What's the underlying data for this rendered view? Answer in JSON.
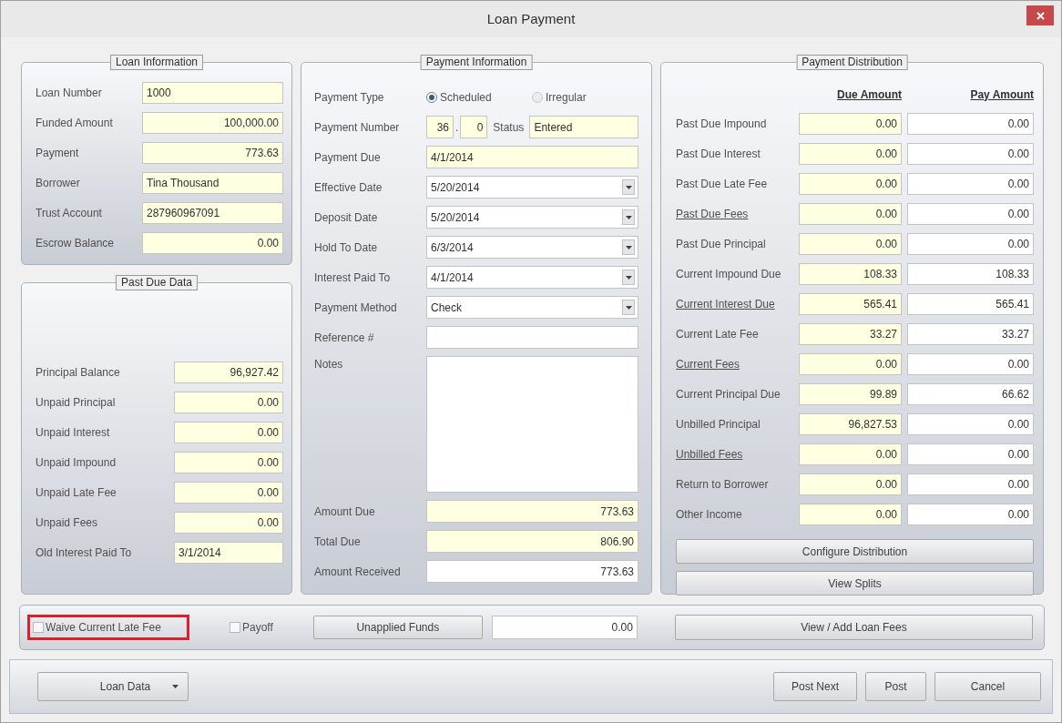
{
  "window": {
    "title": "Loan Payment"
  },
  "loan_information": {
    "title": "Loan Information",
    "fields": [
      {
        "label": "Loan Number",
        "value": "1000",
        "kind": "text"
      },
      {
        "label": "Funded Amount",
        "value": "100,000.00",
        "kind": "amount"
      },
      {
        "label": "Payment",
        "value": "773.63",
        "kind": "amount"
      },
      {
        "label": "Borrower",
        "value": "Tina Thousand",
        "kind": "text"
      },
      {
        "label": "Trust Account",
        "value": "287960967091",
        "kind": "text"
      },
      {
        "label": "Escrow Balance",
        "value": "0.00",
        "kind": "amount"
      }
    ]
  },
  "past_due_data": {
    "title": "Past Due Data",
    "fields": [
      {
        "label": "Principal Balance",
        "value": "96,927.42",
        "kind": "amount"
      },
      {
        "label": "Unpaid Principal",
        "value": "0.00",
        "kind": "amount"
      },
      {
        "label": "Unpaid Interest",
        "value": "0.00",
        "kind": "amount"
      },
      {
        "label": "Unpaid Impound",
        "value": "0.00",
        "kind": "amount"
      },
      {
        "label": "Unpaid Late Fee",
        "value": "0.00",
        "kind": "amount"
      },
      {
        "label": "Unpaid Fees",
        "value": "0.00",
        "kind": "amount"
      },
      {
        "label": "Old Interest Paid To",
        "value": "3/1/2014",
        "kind": "text"
      }
    ]
  },
  "payment_information": {
    "title": "Payment Information",
    "payment_type": {
      "label": "Payment Type",
      "options": [
        {
          "label": "Scheduled",
          "selected": true
        },
        {
          "label": "Irregular",
          "selected": false
        }
      ]
    },
    "payment_number": {
      "label": "Payment Number",
      "number": "36",
      "separator": ".",
      "sequence": "0",
      "status_label": "Status",
      "status": "Entered"
    },
    "rows": [
      {
        "label": "Payment Due",
        "value": "4/1/2014",
        "kind": "readonly"
      },
      {
        "label": "Effective Date",
        "value": "5/20/2014",
        "kind": "dropdown"
      },
      {
        "label": "Deposit Date",
        "value": "5/20/2014",
        "kind": "dropdown"
      },
      {
        "label": "Hold To Date",
        "value": "6/3/2014",
        "kind": "dropdown"
      },
      {
        "label": "Interest Paid To",
        "value": "4/1/2014",
        "kind": "dropdown"
      },
      {
        "label": "Payment Method",
        "value": "Check",
        "kind": "dropdown"
      },
      {
        "label": "Reference #",
        "kind": "input"
      },
      {
        "label": "Notes",
        "kind": "textarea"
      },
      {
        "label": "Amount Due",
        "value": "773.63",
        "kind": "readonly_amount"
      },
      {
        "label": "Total Due",
        "value": "806.90",
        "kind": "readonly_amount"
      },
      {
        "label": "Amount Received",
        "value": "773.63",
        "kind": "input_amount"
      }
    ]
  },
  "payment_distribution": {
    "title": "Payment Distribution",
    "columns": [
      "Due Amount",
      "Pay Amount"
    ],
    "rows": [
      {
        "label": "Past Due Impound",
        "link": false,
        "due": "0.00",
        "pay": "0.00"
      },
      {
        "label": "Past Due Interest",
        "link": false,
        "due": "0.00",
        "pay": "0.00"
      },
      {
        "label": "Past Due Late Fee",
        "link": false,
        "due": "0.00",
        "pay": "0.00"
      },
      {
        "label": "Past Due Fees",
        "link": true,
        "due": "0.00",
        "pay": "0.00"
      },
      {
        "label": "Past Due Principal",
        "link": false,
        "due": "0.00",
        "pay": "0.00"
      },
      {
        "label": "Current Impound Due",
        "link": false,
        "due": "108.33",
        "pay": "108.33"
      },
      {
        "label": "Current Interest Due",
        "link": true,
        "due": "565.41",
        "pay": "565.41"
      },
      {
        "label": "Current Late Fee",
        "link": false,
        "due": "33.27",
        "pay": "33.27"
      },
      {
        "label": "Current Fees",
        "link": true,
        "due": "0.00",
        "pay": "0.00"
      },
      {
        "label": "Current Principal Due",
        "link": false,
        "due": "99.89",
        "pay": "66.62"
      },
      {
        "label": "Unbilled Principal",
        "link": false,
        "due": "96,827.53",
        "pay": "0.00"
      },
      {
        "label": "Unbilled Fees",
        "link": true,
        "due": "0.00",
        "pay": "0.00"
      },
      {
        "label": "Return to Borrower",
        "link": false,
        "due": "0.00",
        "pay": "0.00"
      },
      {
        "label": "Other Income",
        "link": false,
        "due": "0.00",
        "pay": "0.00"
      }
    ],
    "buttons": [
      "Configure Distribution",
      "View Splits"
    ]
  },
  "options_bar": {
    "waive_late_fee": {
      "label": "Waive Current Late Fee",
      "checked": false,
      "highlighted": true
    },
    "payoff": {
      "label": "Payoff",
      "checked": false
    },
    "unapplied_funds_button": "Unapplied Funds",
    "unapplied_funds": "0.00",
    "loan_fees_button": "View / Add Loan Fees"
  },
  "footer": {
    "loan_data_button": "Loan Data",
    "buttons": [
      "Post Next",
      "Post",
      "Cancel"
    ]
  }
}
